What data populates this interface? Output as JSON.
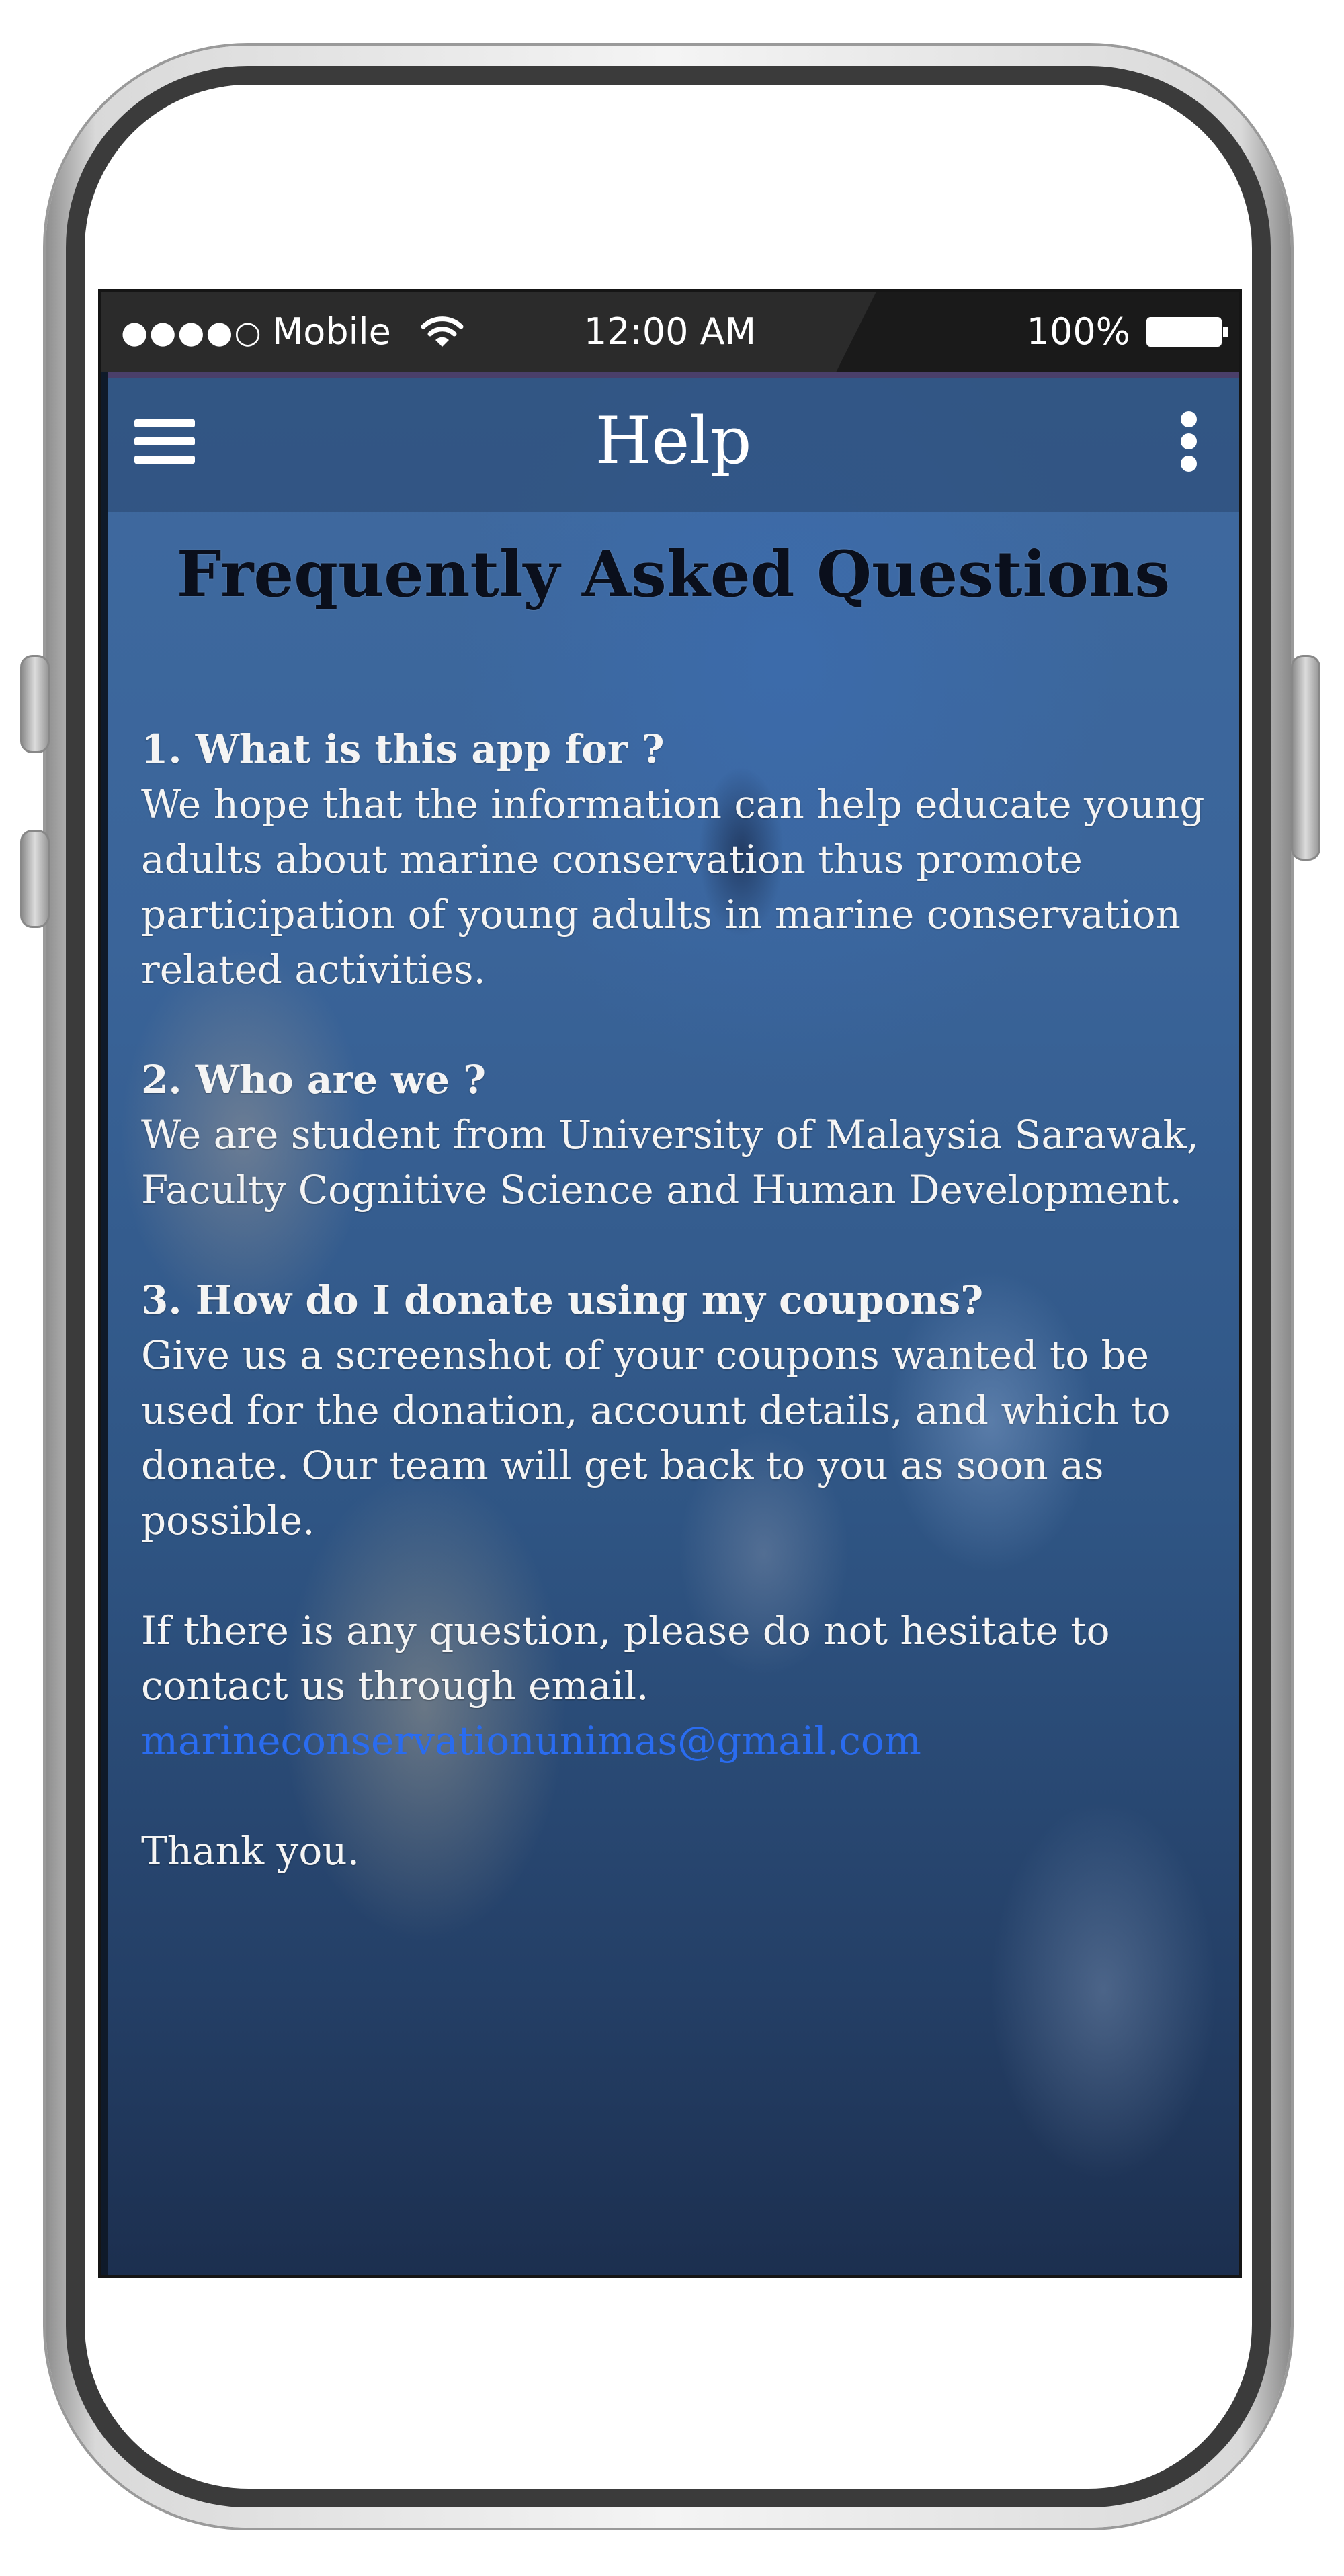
{
  "status_bar": {
    "signal": "●●●●○",
    "carrier": "Mobile",
    "time": "12:00 AM",
    "battery": "100%"
  },
  "app_bar": {
    "title": "Help",
    "menu_icon": "hamburger-menu-icon",
    "more_icon": "more-vertical-icon"
  },
  "faq": {
    "heading": "Frequently Asked Questions",
    "items": [
      {
        "question": "1.  What is this app for ?",
        "answer": "We hope that the information can help educate young adults about marine conservation thus promote participation of young adults in marine conservation related activities."
      },
      {
        "question": "2.  Who are we ?",
        "answer": "We are student from University of Malaysia Sarawak, Faculty Cognitive Science and Human Development."
      },
      {
        "question": "3. How do I donate using my coupons?",
        "answer": "Give us a screenshot of your coupons wanted to be used for the donation, account details, and which to donate. Our team will get back to you as soon as possible."
      }
    ],
    "contact_text": "If there is any question, please do not hesitate to contact us through email.",
    "email": "marineconservationunimas@gmail.com",
    "closing": "Thank you."
  },
  "colors": {
    "link": "#2a6cf0",
    "heading": "#0a0f1c",
    "status_bar": "#2b2b2b"
  }
}
